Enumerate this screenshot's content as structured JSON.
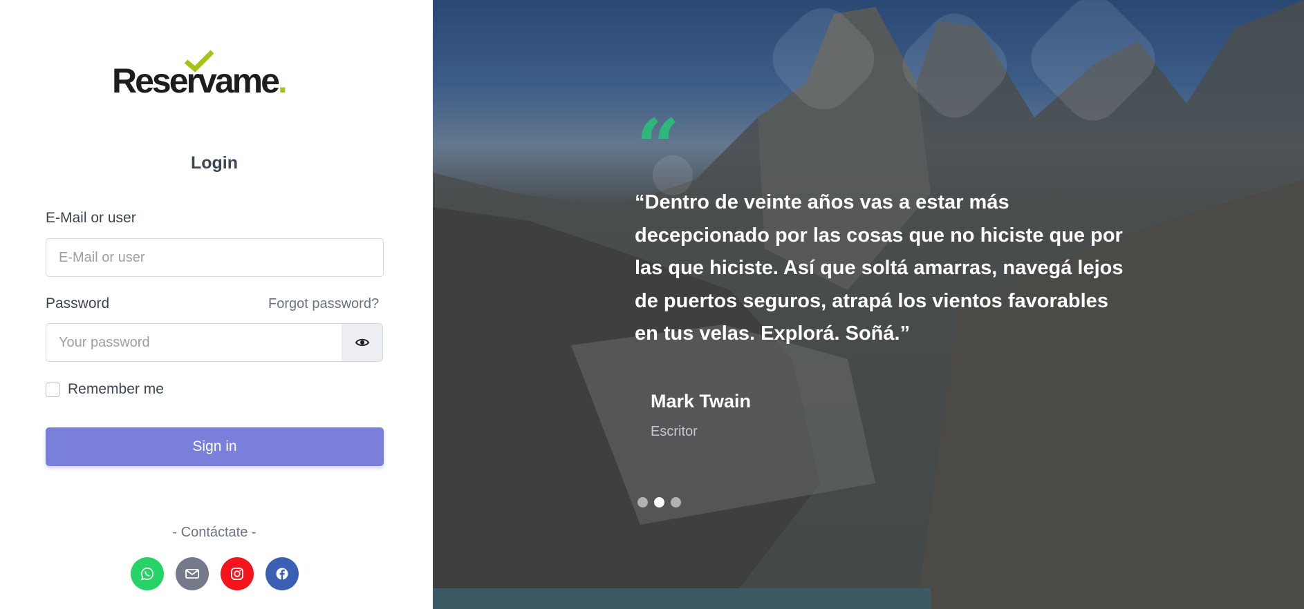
{
  "brand": {
    "name": "Reservame",
    "dot": ".",
    "colors": {
      "text": "#1d1d1b",
      "accent": "#a8c317"
    }
  },
  "login": {
    "title": "Login",
    "email_label": "E-Mail or user",
    "email_placeholder": "E-Mail or user",
    "password_label": "Password",
    "forgot_link": "Forgot password?",
    "password_placeholder": "Your password",
    "toggle_icon": "eye-icon",
    "remember_label": "Remember me",
    "submit_label": "Sign in",
    "submit_color": "#7a7fdb"
  },
  "contact": {
    "heading": "- Contáctate -",
    "links": [
      {
        "name": "whatsapp",
        "icon": "whatsapp-icon",
        "color": "#25d366"
      },
      {
        "name": "email",
        "icon": "mail-icon",
        "color": "#757a8a"
      },
      {
        "name": "instagram",
        "icon": "instagram-icon",
        "color": "#f5141b"
      },
      {
        "name": "facebook",
        "icon": "facebook-icon",
        "color": "#3b5fb3"
      }
    ]
  },
  "testimonial": {
    "quote": "“Dentro de veinte años vas a estar más decepcionado por las cosas que no hiciste que por las que hiciste. Así que soltá amarras, navegá lejos de puertos seguros, atrapá los vientos favorables en tus velas. Explorá. Soñá.”",
    "quote_mark": "“",
    "quote_mark_color": "#2fb67a",
    "author": "Mark Twain",
    "role": "Escritor",
    "slides": 3,
    "active_slide": 2
  }
}
